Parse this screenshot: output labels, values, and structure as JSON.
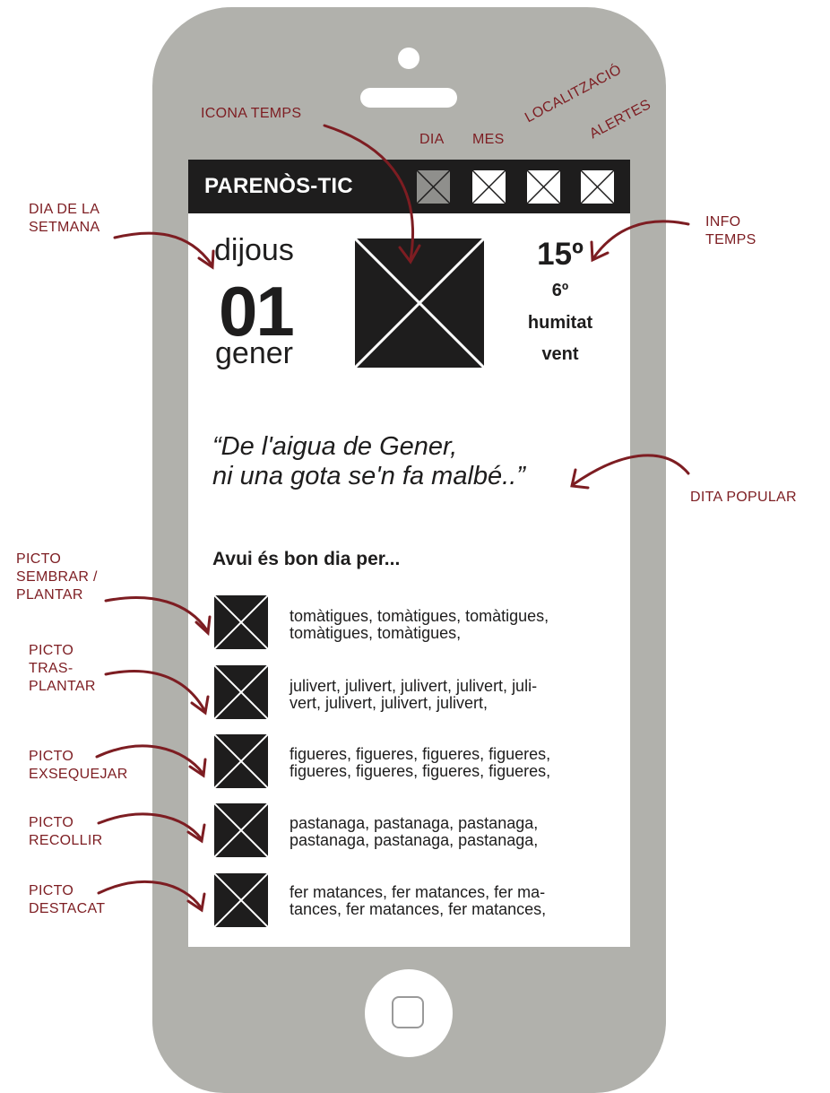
{
  "app": {
    "title": "PARENÒS-TIC",
    "colors": {
      "phone_body": "#b1b1ac",
      "header_bar": "#1e1d1d",
      "annotation": "#7d1d22",
      "active_tab": "#8f8f8c"
    }
  },
  "header_buttons": [
    {
      "name": "dia-button",
      "icon": "placeholder-x-icon",
      "active": true
    },
    {
      "name": "mes-button",
      "icon": "placeholder-x-icon",
      "active": false
    },
    {
      "name": "localitzacio-button",
      "icon": "placeholder-x-icon",
      "active": false
    },
    {
      "name": "alertes-button",
      "icon": "placeholder-x-icon",
      "active": false
    }
  ],
  "date": {
    "weekday": "dijous",
    "day": "01",
    "month": "gener"
  },
  "weather": {
    "icon": "weather-placeholder-icon",
    "temp_max": "15º",
    "temp_min": "6º",
    "humidity": "humitat",
    "wind": "vent"
  },
  "quote": {
    "line1": "“De l'aigua de Gener,",
    "line2": "ni una gota se'n fa malbé..”"
  },
  "today": {
    "heading": "Avui és bon dia per...",
    "rows": [
      {
        "icon": "sembrar-plantar-icon",
        "line1": "tomàtigues, tomàtigues, tomàtigues,",
        "line2": "tomàtigues, tomàtigues,"
      },
      {
        "icon": "trasplantar-icon",
        "line1": "julivert, julivert, julivert, julivert, juli-",
        "line2": "vert, julivert, julivert, julivert,"
      },
      {
        "icon": "exsequejar-icon",
        "line1": "figueres, figueres, figueres, figueres,",
        "line2": "figueres, figueres, figueres, figueres,"
      },
      {
        "icon": "recollir-icon",
        "line1": "pastanaga, pastanaga, pastanaga,",
        "line2": "pastanaga, pastanaga, pastanaga,"
      },
      {
        "icon": "destacat-icon",
        "line1": "fer matances, fer matances, fer ma-",
        "line2": "tances, fer matances, fer matances,"
      }
    ]
  },
  "annotations": {
    "icona_temps": "ICONA TEMPS",
    "dia": "DIA",
    "mes": "MES",
    "localitzacio": "LOCALITZACIÓ",
    "alertes": "ALERTES",
    "dia_setmana_1": "DIA DE LA",
    "dia_setmana_2": "SETMANA",
    "info_temps_1": "INFO",
    "info_temps_2": "TEMPS",
    "dita_popular": "DITA POPULAR",
    "picto_sembrar_1": "PICTO",
    "picto_sembrar_2": "SEMBRAR /",
    "picto_sembrar_3": "PLANTAR",
    "picto_tras_1": "PICTO",
    "picto_tras_2": "TRAS-",
    "picto_tras_3": "PLANTAR",
    "picto_exse_1": "PICTO",
    "picto_exse_2": "EXSEQUEJAR",
    "picto_recollir_1": "PICTO",
    "picto_recollir_2": "RECOLLIR",
    "picto_destacat_1": "PICTO",
    "picto_destacat_2": "DESTACAT"
  }
}
